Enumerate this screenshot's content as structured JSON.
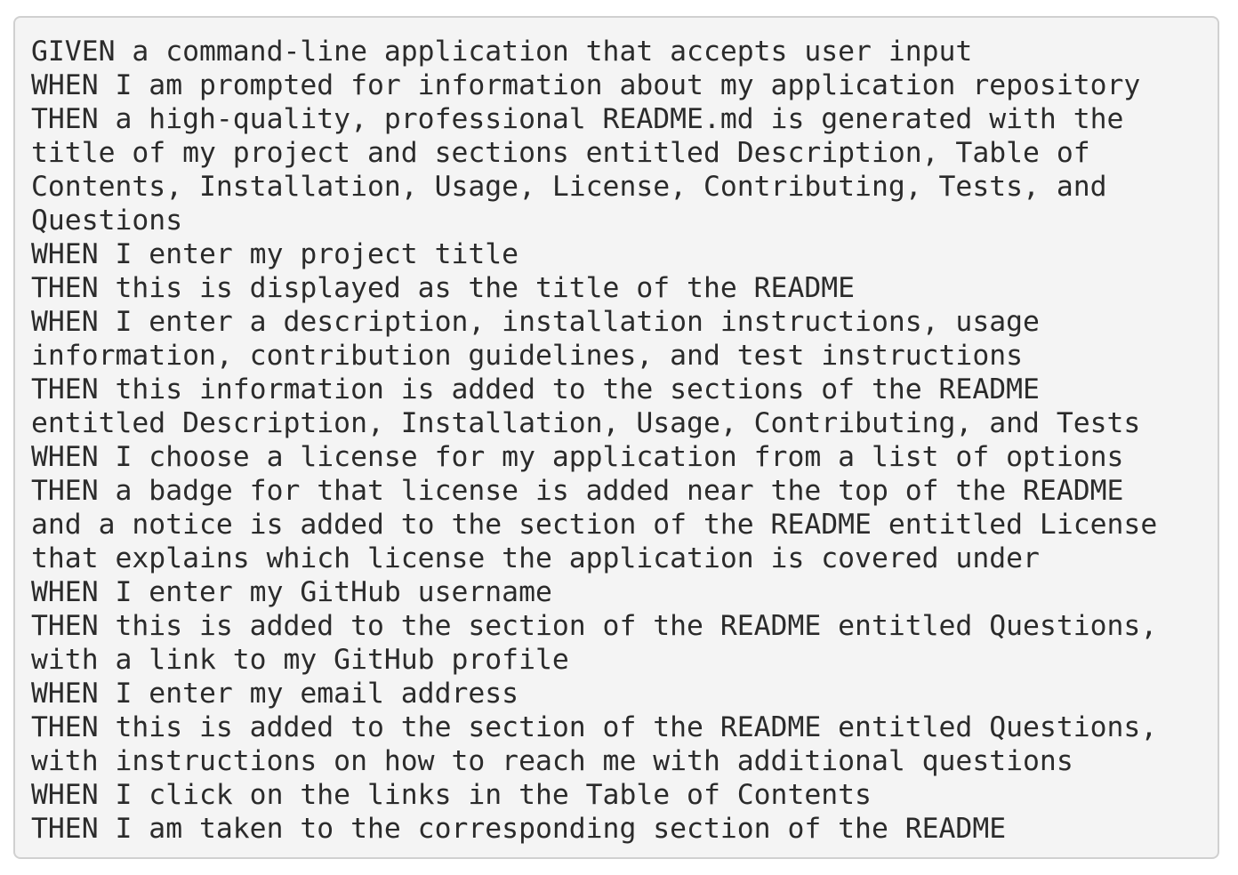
{
  "code_block": {
    "lines": [
      "GIVEN a command-line application that accepts user input",
      "WHEN I am prompted for information about my application repository",
      "THEN a high-quality, professional README.md is generated with the",
      "title of my project and sections entitled Description, Table of",
      "Contents, Installation, Usage, License, Contributing, Tests, and",
      "Questions",
      "WHEN I enter my project title",
      "THEN this is displayed as the title of the README",
      "WHEN I enter a description, installation instructions, usage",
      "information, contribution guidelines, and test instructions",
      "THEN this information is added to the sections of the README",
      "entitled Description, Installation, Usage, Contributing, and Tests",
      "WHEN I choose a license for my application from a list of options",
      "THEN a badge for that license is added near the top of the README",
      "and a notice is added to the section of the README entitled License",
      "that explains which license the application is covered under",
      "WHEN I enter my GitHub username",
      "THEN this is added to the section of the README entitled Questions,",
      "with a link to my GitHub profile",
      "WHEN I enter my email address",
      "THEN this is added to the section of the README entitled Questions,",
      "with instructions on how to reach me with additional questions",
      "WHEN I click on the links in the Table of Contents",
      "THEN I am taken to the corresponding section of the README"
    ]
  },
  "colors": {
    "background": "#f4f4f4",
    "border": "#d0d0d0",
    "text": "#2b2b2b"
  }
}
